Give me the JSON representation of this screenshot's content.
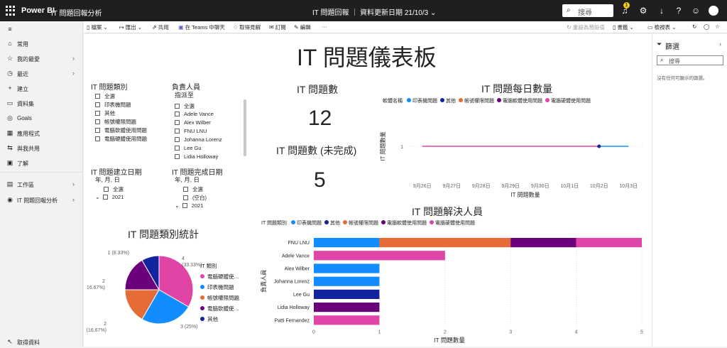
{
  "topbar": {
    "brand": "Power BI",
    "workspace": "IT 問題回報分析",
    "center": "IT 問題回報 ｜ 資料更新日期 21/10/3 ⌄",
    "search_placeholder": "搜尋",
    "notification_count": "1"
  },
  "leftnav": {
    "items": [
      {
        "icon": "⌂",
        "label": "常用"
      },
      {
        "icon": "☆",
        "label": "我的最愛"
      },
      {
        "icon": "◷",
        "label": "最近"
      },
      {
        "icon": "+",
        "label": "建立"
      },
      {
        "icon": "▭",
        "label": "資料集"
      },
      {
        "icon": "◎",
        "label": "Goals"
      },
      {
        "icon": "▦",
        "label": "應用程式"
      },
      {
        "icon": "⇆",
        "label": "與我共用"
      },
      {
        "icon": "▣",
        "label": "了解"
      },
      {
        "icon": "▤",
        "label": "工作區"
      },
      {
        "icon": "◉",
        "label": "IT 問題回報分析"
      }
    ],
    "get_data": "取得資料"
  },
  "toolbar": {
    "file": "檔案",
    "export": "匯出",
    "share": "共用",
    "teams": "在 Teams 中聊天",
    "insights": "取得見解",
    "subscribe": "訂閱",
    "edit": "編輯",
    "more": "···",
    "reset": "重設為預設值",
    "bookmarks": "書籤",
    "view": "檢視表"
  },
  "canvas": {
    "title": "IT 問題儀表板",
    "slicer_type": {
      "title": "IT 問題類別",
      "items": [
        "全選",
        "印表機問題",
        "其他",
        "帳號權限問題",
        "電腦軟體使用問題",
        "電腦硬體使用問題"
      ]
    },
    "slicer_owner": {
      "title": "負責人員",
      "subtitle": "指派至",
      "items": [
        "全選",
        "Adele Vance",
        "Alex Wilber",
        "FNU LNU",
        "Johanna Lorenz",
        "Lee Gu",
        "Lidia Holloway"
      ]
    },
    "slicer_created": {
      "title": "IT 問題建立日期",
      "hierarchy": "年, 月, 日",
      "items": [
        "全選",
        "2021"
      ]
    },
    "slicer_completed": {
      "title": "IT 問題完成日期",
      "hierarchy": "年, 月, 日",
      "items": [
        "全選",
        "(空白)",
        "2021"
      ]
    },
    "card_count": {
      "title": "IT 問題數",
      "value": "12"
    },
    "card_open": {
      "title": "IT 問題數 (未完成)",
      "value": "5"
    }
  },
  "filterpane": {
    "title": "篩選",
    "search_placeholder": "搜尋",
    "empty_text": "沒有任何可顯示的篩選。"
  },
  "colors": {
    "printer": "#118dff",
    "other": "#12239e",
    "account": "#e66c37",
    "software": "#6b007b",
    "hardware": "#e044a7"
  },
  "chart_data": [
    {
      "type": "line",
      "title": "IT 問題每日數量",
      "legend_title": "軟體名稱",
      "legend": [
        "印表機問題",
        "其他",
        "帳號權限問題",
        "電腦軟體使用問題",
        "電腦硬體使用問題"
      ],
      "xlabel": "IT 問題數量",
      "ylabel": "IT 問題數量",
      "x": [
        "9月26日",
        "9月27日",
        "9月28日",
        "9月29日",
        "9月30日",
        "10月1日",
        "10月2日",
        "10月3日"
      ],
      "ylim": [
        0,
        2
      ],
      "yticks": [
        "1"
      ],
      "series": [
        {
          "name": "電腦硬體使用問題",
          "values": [
            1,
            1,
            1,
            1,
            1,
            1,
            1,
            null
          ]
        },
        {
          "name": "印表機問題",
          "values": [
            null,
            null,
            null,
            null,
            null,
            null,
            1,
            1
          ]
        },
        {
          "name": "其他",
          "values": [
            null,
            null,
            null,
            null,
            null,
            null,
            1,
            null
          ]
        }
      ]
    },
    {
      "type": "pie",
      "title": "IT 問題類別統計",
      "legend_title": "IT 類別",
      "legend": [
        "電腦硬體使…",
        "印表機問題",
        "帳號權限問題",
        "電腦軟體使…",
        "其他"
      ],
      "slices": [
        {
          "name": "電腦硬體使用問題",
          "value": 4,
          "label": "4\n(33.33%)"
        },
        {
          "name": "印表機問題",
          "value": 3,
          "label": "3 (25%)"
        },
        {
          "name": "帳號權限問題",
          "value": 2,
          "label": "2\n(16.67%)"
        },
        {
          "name": "電腦軟體使用問題",
          "value": 2,
          "label": "2\n(16.67%)"
        },
        {
          "name": "其他",
          "value": 1,
          "label": "1 (8.33%)"
        }
      ]
    },
    {
      "type": "bar",
      "orientation": "horizontal",
      "stacked": true,
      "title": "IT 問題解決人員",
      "legend_title": "IT 問題類別",
      "legend": [
        "印表機問題",
        "其他",
        "帳號權限問題",
        "電腦軟體使用問題",
        "電腦硬體使用問題"
      ],
      "categories": [
        "FNU LNU",
        "Adele Vance",
        "Alex Wilber",
        "Johanna Lorenz",
        "Lee Gu",
        "Lidia Holloway",
        "Patti Fernandez"
      ],
      "xlabel": "IT 問題數量",
      "ylabel": "負責人員",
      "xlim": [
        0,
        5
      ],
      "xticks": [
        "0",
        "1",
        "2",
        "3",
        "4",
        "5"
      ],
      "series": [
        {
          "name": "印表機問題",
          "values": [
            1,
            0,
            1,
            1,
            0,
            0,
            0
          ]
        },
        {
          "name": "其他",
          "values": [
            0,
            0,
            0,
            0,
            1,
            0,
            0
          ]
        },
        {
          "name": "帳號權限問題",
          "values": [
            2,
            0,
            0,
            0,
            0,
            0,
            0
          ]
        },
        {
          "name": "電腦軟體使用問題",
          "values": [
            1,
            0,
            0,
            0,
            0,
            1,
            0
          ]
        },
        {
          "name": "電腦硬體使用問題",
          "values": [
            1,
            2,
            0,
            0,
            0,
            0,
            1
          ]
        }
      ]
    }
  ]
}
